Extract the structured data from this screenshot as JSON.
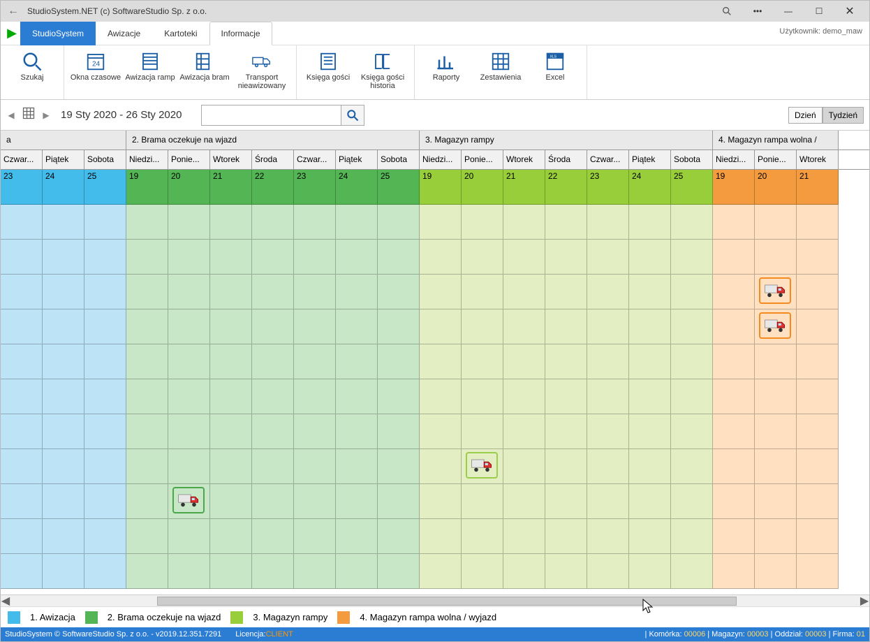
{
  "window": {
    "title": "StudioSystem.NET (c) SoftwareStudio Sp. z o.o."
  },
  "menu": {
    "primary": "StudioSystem",
    "items": [
      "Awizacje",
      "Kartoteki",
      "Informacje"
    ],
    "active": 2,
    "user": "Użytkownik: demo_maw"
  },
  "toolbar": {
    "search": "Szukaj",
    "okna": "Okna czasowe",
    "ramp": "Awizacja ramp",
    "bram": "Awizacja bram",
    "transport": "Transport nieawizowany",
    "ksiega": "Księga gości",
    "ksiegah": "Księga gości historia",
    "raporty": "Raporty",
    "zest": "Zestawienia",
    "excel": "Excel"
  },
  "subbar": {
    "range": "19 Sty 2020 - 26 Sty 2020",
    "placeholder": "",
    "day": "Dzień",
    "week": "Tydzień"
  },
  "groups": [
    {
      "name": "a",
      "cls": "c1",
      "days": [
        "Czwar...",
        "Piątek",
        "Sobota"
      ],
      "nums": [
        "23",
        "24",
        "25"
      ]
    },
    {
      "name": "2. Brama oczekuje na wjazd",
      "cls": "c2",
      "days": [
        "Niedzi...",
        "Ponie...",
        "Wtorek",
        "Środa",
        "Czwar...",
        "Piątek",
        "Sobota"
      ],
      "nums": [
        "19",
        "20",
        "21",
        "22",
        "23",
        "24",
        "25"
      ]
    },
    {
      "name": "3. Magazyn rampy",
      "cls": "c3",
      "days": [
        "Niedzi...",
        "Ponie...",
        "Wtorek",
        "Środa",
        "Czwar...",
        "Piątek",
        "Sobota"
      ],
      "nums": [
        "19",
        "20",
        "21",
        "22",
        "23",
        "24",
        "25"
      ]
    },
    {
      "name": "4. Magazyn rampa wolna /",
      "cls": "c4",
      "days": [
        "Niedzi...",
        "Ponie...",
        "Wtorek"
      ],
      "nums": [
        "19",
        "20",
        "21"
      ]
    }
  ],
  "legend": {
    "l1": "1. Awizacja",
    "l2": "2. Brama oczekuje na wjazd",
    "l3": "3. Magazyn rampy",
    "l4": "4. Magazyn rampa wolna / wyjazd"
  },
  "status": {
    "left": "StudioSystem © SoftwareStudio Sp. z o.o. - v2019.12.351.7291",
    "lic_label": "Licencja: ",
    "lic": "CLIENT",
    "right_labels": {
      "kom": "Komórka:",
      "mag": "Magazyn:",
      "odd": "Oddział:",
      "fir": "Firma:"
    },
    "right_vals": {
      "kom": "00006",
      "mag": "00003",
      "odd": "00003",
      "fir": "01"
    }
  }
}
